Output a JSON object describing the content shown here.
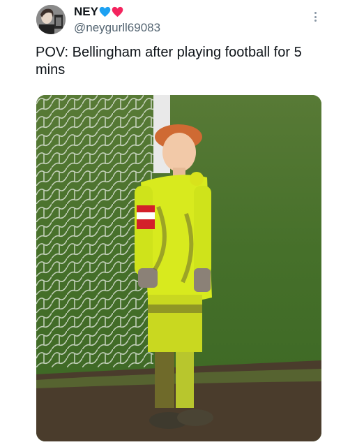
{
  "tweet": {
    "display_name": "NEY",
    "handle": "@neygurll69083",
    "text": "POV: Bellingham after playing football for 5 mins",
    "badges": [
      "blue-heart-icon",
      "red-heart-icon"
    ],
    "more_icon": "more-icon"
  },
  "colors": {
    "text": "#0f1419",
    "secondary": "#536471",
    "blue_heart": "#1da1f2",
    "red_heart": "#f4245e"
  }
}
